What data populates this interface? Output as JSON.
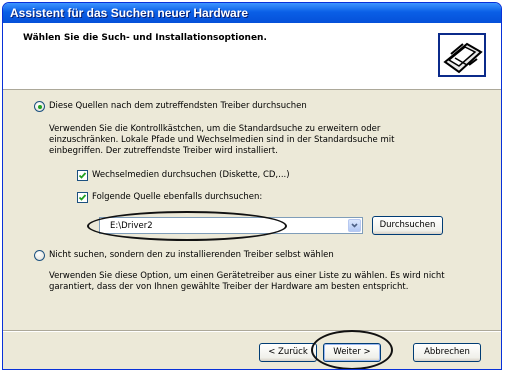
{
  "window": {
    "title": "Assistent für das Suchen neuer Hardware",
    "header_title": "Wählen Sie die Such- und Installationsoptionen."
  },
  "option_search": {
    "label": "Diese Quellen nach dem zutreffendsten Treiber durchsuchen",
    "selected": true,
    "description": "Verwenden Sie die Kontrollkästchen, um die Standardsuche zu erweitern oder einzuschränken. Lokale Pfade und Wechselmedien sind in der Standardsuche mit einbegriffen. Der zutreffendste Treiber wird installiert.",
    "removable_media": {
      "label": "Wechselmedien durchsuchen (Diskette, CD,...)",
      "checked": true
    },
    "include_location": {
      "label": "Folgende Quelle ebenfalls durchsuchen:",
      "checked": true
    },
    "location_value": "E:\\Driver2",
    "browse_label": "Durchsuchen"
  },
  "option_manual": {
    "label": "Nicht suchen, sondern den zu installierenden Treiber selbst wählen",
    "selected": false,
    "description": "Verwenden Sie diese Option, um einen Gerätetreiber aus einer Liste zu wählen. Es wird nicht garantiert, dass der von Ihnen gewählte Treiber der Hardware am besten entspricht."
  },
  "buttons": {
    "back": "< Zurück",
    "next": "Weiter >",
    "cancel": "Abbrechen"
  },
  "colors": {
    "title_bar": "#0a5fe6",
    "dialog_face": "#ece9d8",
    "radio_dot": "#21a121"
  }
}
